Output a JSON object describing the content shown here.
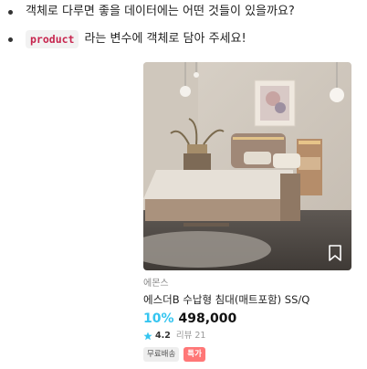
{
  "bullets": {
    "line1": "객체로 다루면 좋을 데이터에는 어떤 것들이 있을까요?",
    "line2_code": "product",
    "line2_text": "라는 변수에 객체로 담아 주세요!"
  },
  "product": {
    "image_alt": "bed product photo",
    "brand": "에몬스",
    "name": "에스더B 수납형 침대(매트포함) SS/Q",
    "discount": "10%",
    "price": "498,000",
    "rating": "4.2",
    "review_label": "리뷰",
    "review_count": "21",
    "badges": {
      "free_shipping": "무료배송",
      "special": "특가"
    }
  },
  "icons": {
    "bookmark": "bookmark-icon",
    "star": "star-icon"
  },
  "colors": {
    "discount": "#35c5f0",
    "code_text": "#c7254e",
    "special_badge": "#ff7777",
    "star": "#35c5f0"
  }
}
